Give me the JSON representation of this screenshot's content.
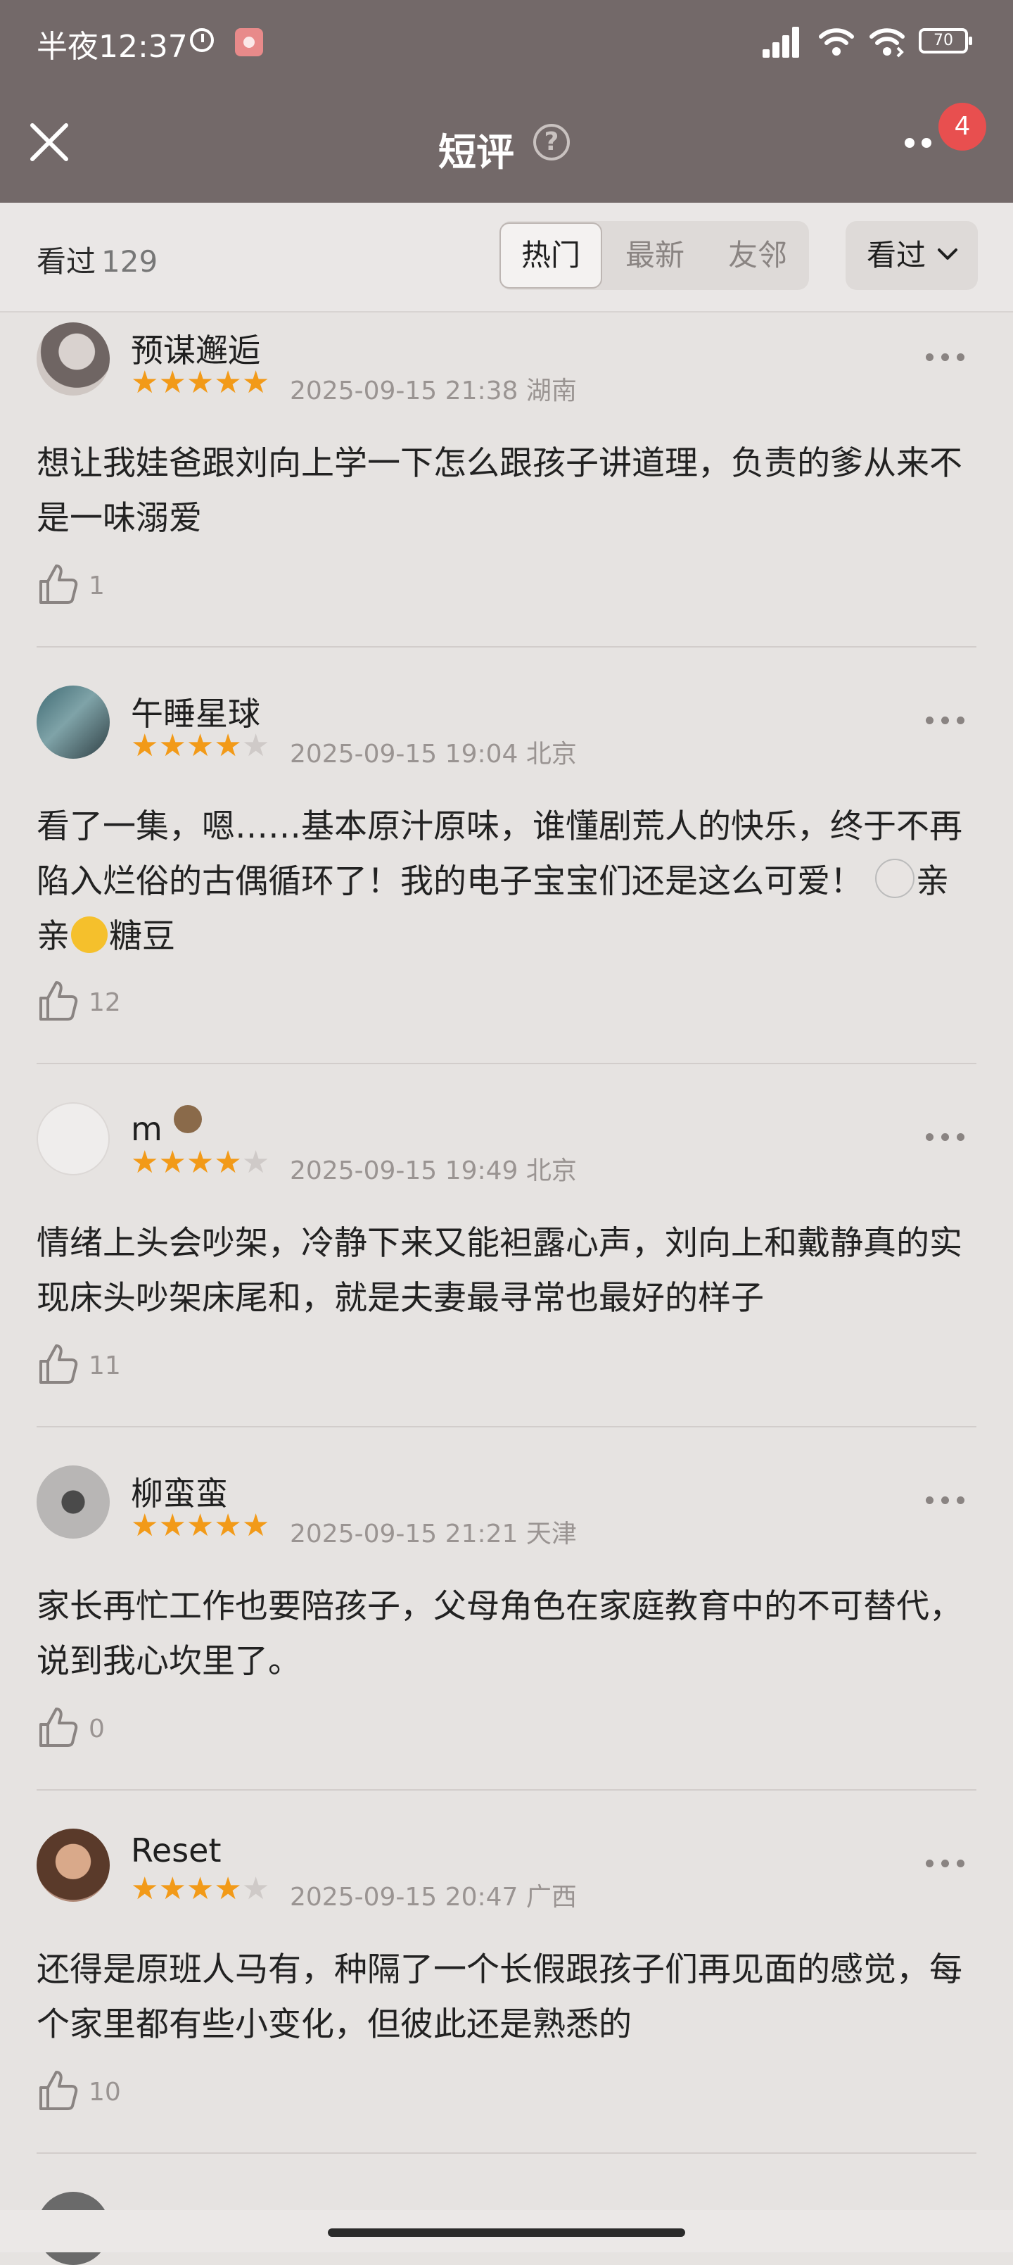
{
  "status_bar": {
    "time": "半夜12:37",
    "battery": "70"
  },
  "nav": {
    "title": "短评",
    "help": "?",
    "badge": "4"
  },
  "filter": {
    "seen_label": "看过",
    "seen_count": "129",
    "tabs": [
      "热门",
      "最新",
      "友邻"
    ],
    "active_tab": "热门",
    "dropdown": "看过"
  },
  "reviews": [
    {
      "name": "预谋邂逅",
      "rating": 5,
      "time": "2025-09-15 21:38",
      "location": "湖南",
      "text": "想让我娃爸跟刘向上学一下怎么跟孩子讲道理，负责的爹从来不是一味溺爱",
      "likes": "1"
    },
    {
      "name": "午睡星球",
      "rating": 4,
      "time": "2025-09-15 19:04",
      "location": "北京",
      "text_a": "看了一集，嗯……基本原汁原味，谁懂剧荒人的快乐，终于不再陷入烂俗的古偶循环了！我的电子宝宝们还是这么可爱！",
      "text_b": "亲亲",
      "text_c": "糖豆",
      "likes": "12"
    },
    {
      "name": "m",
      "rating": 4,
      "time": "2025-09-15 19:49",
      "location": "北京",
      "text": "情绪上头会吵架，冷静下来又能袒露心声，刘向上和戴静真的实现床头吵架床尾和，就是夫妻最寻常也最好的样子",
      "likes": "11"
    },
    {
      "name": "柳蛮蛮",
      "rating": 5,
      "time": "2025-09-15 21:21",
      "location": "天津",
      "text": "家长再忙工作也要陪孩子，父母角色在家庭教育中的不可替代，说到我心坎里了。",
      "likes": "0"
    },
    {
      "name": "Reset",
      "rating": 4,
      "time": "2025-09-15 20:47",
      "location": "广西",
      "text": "还得是原班人马有，种隔了一个长假跟孩子们再见面的感觉，每个家里都有些小变化，但彼此还是熟悉的",
      "likes": "10"
    }
  ],
  "colors": {
    "nav_bg": "#736969",
    "star": "#f29a18",
    "badge": "#e84f4f"
  }
}
